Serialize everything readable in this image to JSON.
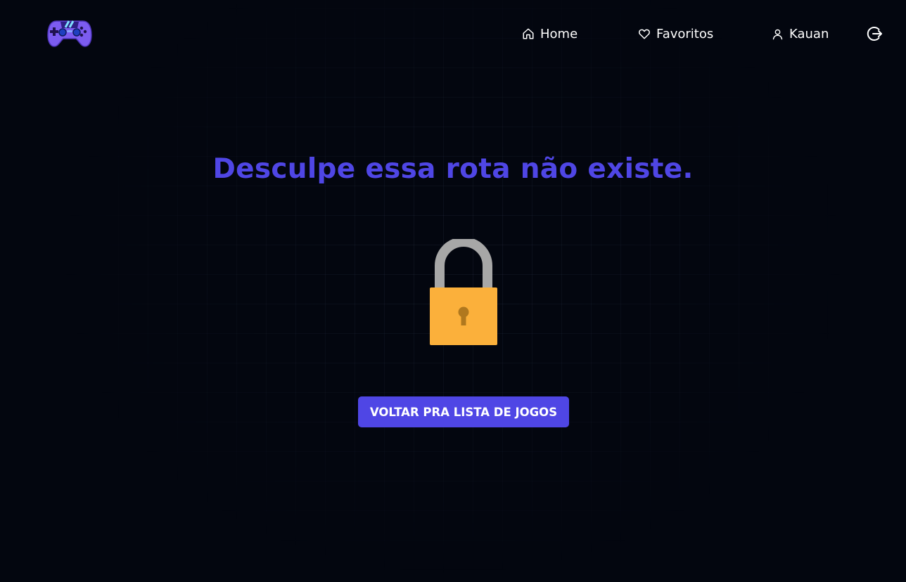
{
  "nav": {
    "logo_icon": "gamepad-logo-icon",
    "items": [
      {
        "label": "Home",
        "icon": "home-icon"
      },
      {
        "label": "Favoritos",
        "icon": "heart-icon"
      },
      {
        "label": "Kauan",
        "icon": "user-icon"
      }
    ],
    "logout_icon": "logout-icon"
  },
  "main": {
    "title": "Desculpe essa rota não existe.",
    "illustration_icon": "padlock-icon",
    "button_label": "VOLTAR PRA LISTA DE JOGOS"
  },
  "colors": {
    "background": "#03060f",
    "accent": "#4f46e5",
    "lock_body": "#fbb03b",
    "lock_shackle": "#a7a7a7"
  }
}
